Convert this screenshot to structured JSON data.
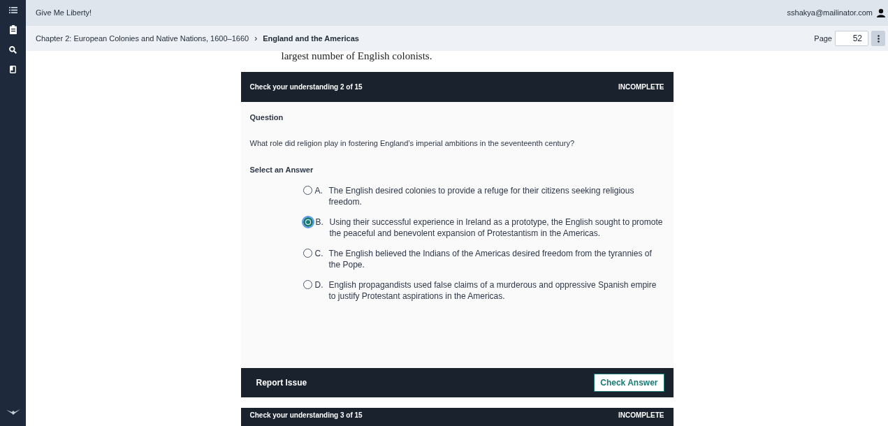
{
  "top_bar": {
    "title": "Give Me Liberty!",
    "user": "sshakya@mailinator.com"
  },
  "breadcrumb": {
    "items": [
      "Chapter 2: European Colonies and Native Nations, 1600–1660",
      "England and the Americas"
    ],
    "separator": "›"
  },
  "page": {
    "label": "Page",
    "value": "52"
  },
  "reading_text": "largest number of English colonists.",
  "quiz": {
    "title": "Check your understanding 2 of 15",
    "status": "INCOMPLETE",
    "question_heading": "Question",
    "question": "What role did religion play in fostering England’s imperial ambitions in the seventeenth century?",
    "answer_heading": "Select an Answer",
    "options": [
      {
        "letter": "A.",
        "text": "The English desired colonies to provide a refuge for their citizens seeking religious freedom.",
        "selected": false
      },
      {
        "letter": "B.",
        "text": "Using their successful experience in Ireland as a prototype, the English sought to promote the peaceful and benevolent expansion of Protestantism in the Americas.",
        "selected": true
      },
      {
        "letter": "C.",
        "text": "The English believed the Indians of the Americas desired freedom from the tyrannies of the Pope.",
        "selected": false
      },
      {
        "letter": "D.",
        "text": "English propagandists used false claims of a murderous and oppressive Spanish empire to justify Protestant aspirations in the Americas.",
        "selected": false
      }
    ],
    "report_label": "Report Issue",
    "check_label": "Check Answer"
  },
  "next_quiz": {
    "title": "Check your understanding 3 of 15",
    "status": "INCOMPLETE"
  }
}
